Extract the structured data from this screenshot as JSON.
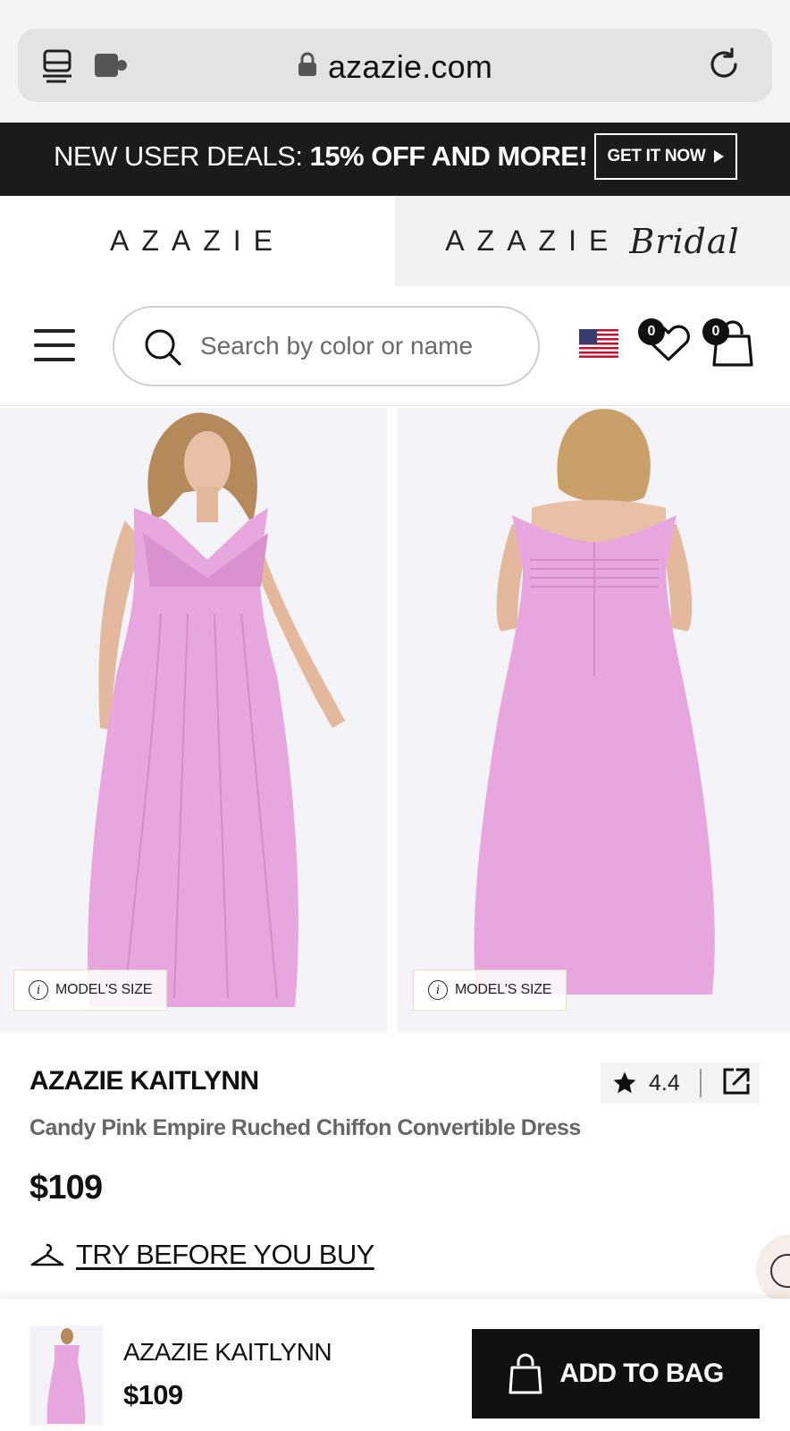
{
  "browser": {
    "url": "azazie.com",
    "icons": [
      "laptop-icon",
      "puzzle-icon",
      "lock-icon",
      "reload-icon"
    ]
  },
  "promo": {
    "text_prefix": "NEW USER DEALS:",
    "text_bold": "15% OFF AND MORE!",
    "button_label": "GET IT NOW"
  },
  "brands": {
    "main": "AZAZIE",
    "bridal_word": "AZAZIE",
    "bridal_script": "Bridal"
  },
  "header": {
    "search_placeholder": "Search by color or name",
    "wishlist_count": "0",
    "bag_count": "0",
    "country": "US"
  },
  "gallery": {
    "model_size_label_1": "MODEL'S SIZE",
    "model_size_label_2": "MODEL'S SIZE",
    "dress_color": "#e7a6de"
  },
  "product": {
    "name": "AZAZIE KAITLYNN",
    "description": "Candy Pink Empire Ruched Chiffon Convertible Dress",
    "price": "$109",
    "rating": "4.4",
    "try_label": "TRY BEFORE YOU BUY"
  },
  "sticky": {
    "name": "AZAZIE KAITLYNN",
    "price": "$109",
    "button_label": "ADD TO BAG"
  }
}
